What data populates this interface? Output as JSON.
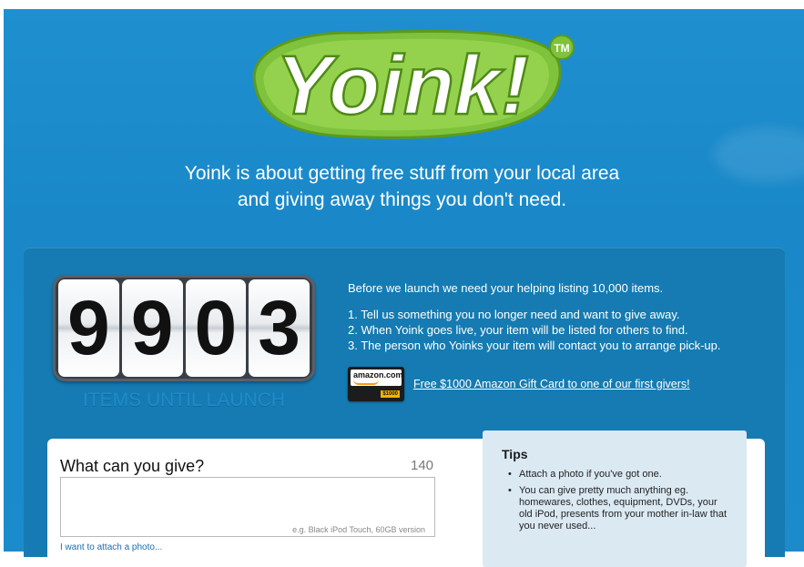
{
  "brand": {
    "name": "Yoink!",
    "trademark": "TM",
    "colors": {
      "green": "#8cc63f",
      "dark_green": "#6aa51f",
      "blue": "#1b8bcb"
    }
  },
  "tagline": {
    "line1": "Yoink is about getting free stuff from your local area",
    "line2": "and giving away things you don't need."
  },
  "counter": {
    "digits": [
      "9",
      "9",
      "0",
      "3"
    ],
    "label": "ITEMS UNTIL LAUNCH"
  },
  "info": {
    "intro": "Before we launch we need your helping listing 10,000 items.",
    "steps": [
      "1. Tell us something you no longer need and want to give away.",
      "2. When Yoink goes live, your item will be listed for others to find.",
      "3. The person who Yoinks your item will contact you to arrange pick-up."
    ]
  },
  "amazon": {
    "card_logo": "amazon.com",
    "card_value": "$1000",
    "link_text": "Free $1000 Amazon Gift Card to one of our first givers!"
  },
  "form": {
    "title": "What can you give?",
    "char_count": "140",
    "placeholder": "e.g. Black iPod Touch, 60GB version",
    "attach_link": "I want to attach a photo..."
  },
  "tips": {
    "title": "Tips",
    "items": [
      "Attach a photo if you've got one.",
      "You can give pretty much anything eg. homewares, clothes, equipment, DVDs, your old iPod, presents from your mother in-law that you never used..."
    ]
  }
}
